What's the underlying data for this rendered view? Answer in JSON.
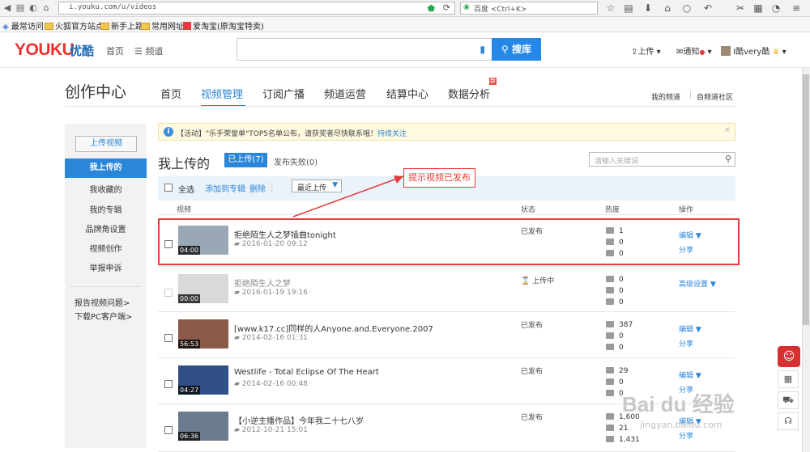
{
  "browser": {
    "url": "i.youku.com/u/videos",
    "search_engine": "百度 <Ctrl+K>",
    "bookmarks": [
      "最常访问",
      "火狐官方站点",
      "新手上路",
      "常用网址",
      "爱淘宝(原淘宝特卖)"
    ]
  },
  "header": {
    "logo": "YOUKU",
    "logo_cn": "优酷",
    "nav_home": "首页",
    "nav_channels": "频道",
    "search_button": "搜库",
    "upload": "上传",
    "notify": "通知",
    "username": "I酷very酷"
  },
  "page": {
    "title": "创作中心",
    "tabs": [
      "首页",
      "视频管理",
      "订阅广播",
      "频道运营",
      "结算中心",
      "数据分析"
    ],
    "tab_new_badge": "新",
    "links_right": [
      "我的频道",
      "自频道社区"
    ]
  },
  "sidebar": {
    "upload_button": "上传视频",
    "items": [
      "我上传的",
      "我收藏的",
      "我的专辑",
      "品牌角设置",
      "视频创作",
      "举报申诉"
    ],
    "extra_links": [
      "报告视频问题>",
      "下载PC客户端>"
    ]
  },
  "notice": {
    "text": "【活动】\"乐手荣誉单\"TOP5名单公布，请获奖者尽快联系哦！",
    "link": "持续关注"
  },
  "section": {
    "title": "我上传的",
    "active_filter": "已上传(7)",
    "failed_filter": "发布失败(0)",
    "search_placeholder": "请输入关键词"
  },
  "toolbar": {
    "select_all": "全选",
    "add_to_album": "添加到专辑",
    "delete": "删除",
    "sort": "最近上传"
  },
  "columns": {
    "video": "视频",
    "status": "状态",
    "heat": "热度",
    "ops": "操作"
  },
  "videos": [
    {
      "title": "拒绝陌生人之梦插曲tonight",
      "date": "2016-01-20 09:12",
      "duration": "04:00",
      "status": "已发布",
      "plays": "1",
      "comments": "0",
      "shares": "0",
      "op1": "编辑",
      "op2": "分享",
      "thumb_color": "#9aa8b6"
    },
    {
      "title": "拒绝陌生人之梦",
      "date": "2016-01-19 19:16",
      "duration": "00:00",
      "status": "上传中",
      "plays": "0",
      "comments": "0",
      "shares": "0",
      "op1": "高级设置",
      "op2": "",
      "thumb_color": "#d9d9d9"
    },
    {
      "title": "[www.k17.cc]同样的人Anyone.and.Everyone.2007",
      "date": "2014-02-16 01:31",
      "duration": "56:53",
      "status": "已发布",
      "plays": "387",
      "comments": "0",
      "shares": "0",
      "op1": "编辑",
      "op2": "分享",
      "thumb_color": "#8a5a4a"
    },
    {
      "title": "Westlife - Total Eclipse Of The Heart",
      "date": "2014-02-16 00:48",
      "duration": "04:27",
      "status": "已发布",
      "plays": "29",
      "comments": "0",
      "shares": "0",
      "op1": "编辑",
      "op2": "分享",
      "thumb_color": "#2f4f86"
    },
    {
      "title": "【小逆主播作品】今年我二十七八岁",
      "date": "2012-10-21 15:01",
      "duration": "06:36",
      "status": "已发布",
      "plays": "1,600",
      "comments": "21",
      "shares": "1,431",
      "op1": "编辑",
      "op2": "分享",
      "thumb_color": "#6c7c8e"
    }
  ],
  "callout": "提示视频已发布",
  "watermark": {
    "main": "Bai du 经验",
    "sub": "jingyan.baidu.com"
  }
}
